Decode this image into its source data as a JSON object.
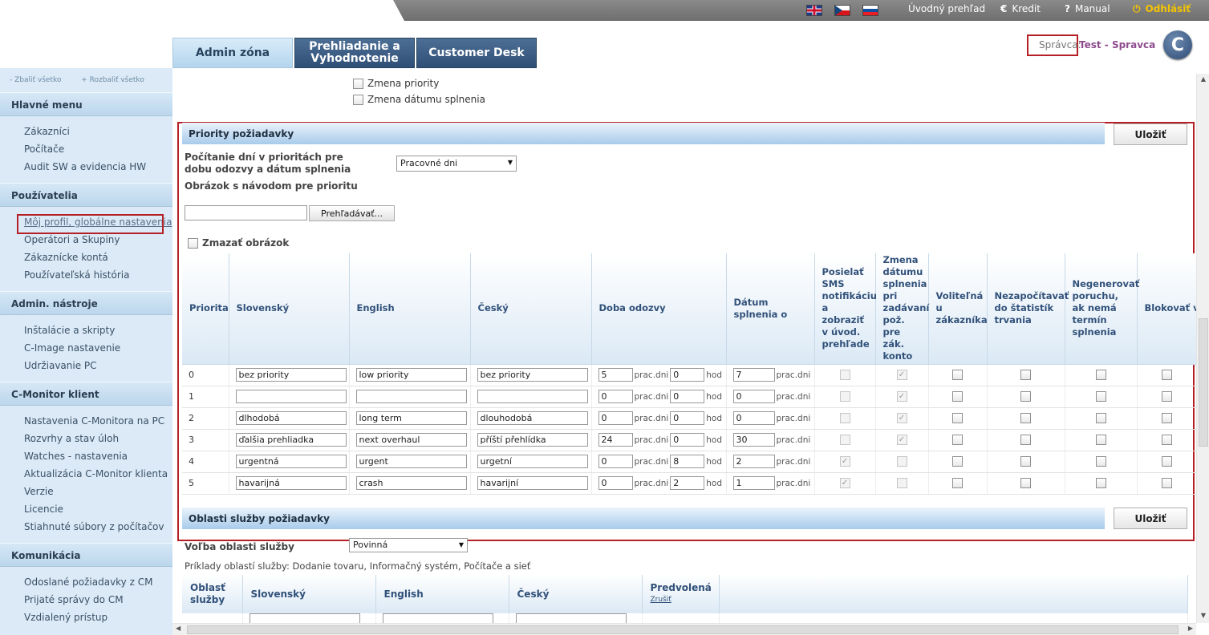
{
  "topbar": {
    "flags": [
      "flag-uk",
      "flag-cz",
      "flag-sk"
    ],
    "home": "Úvodný prehľad",
    "credit_icon": "€",
    "credit": "Kredit",
    "manual_icon": "?",
    "manual": "Manual",
    "logout_icon": "⏻",
    "logout": "Odhlásiť"
  },
  "tabs": {
    "admin": "Admin zóna",
    "review_1": "Prehliadanie a",
    "review_2": "Vyhodnotenie",
    "desk": "Customer Desk"
  },
  "user": {
    "label": "Správca:",
    "name": "Test - Spravca",
    "logo": "C"
  },
  "sidebar": {
    "collapse_all": "- Zbaliť všetko",
    "expand_all": "+ Rozbaliť všetko",
    "sections": [
      {
        "title": "Hlavné menu",
        "items": [
          "Zákazníci",
          "Počítače",
          "Audit SW a evidencia HW"
        ]
      },
      {
        "title": "Používatelia",
        "items": [
          "Môj profil, globálne nastavenia",
          "Operátori a Skupiny",
          "Zákaznícke kontá",
          "Používateľská história"
        ]
      },
      {
        "title": "Admin. nástroje",
        "items": [
          "Inštalácie a skripty",
          "C-Image nastavenie",
          "Udržiavanie PC"
        ]
      },
      {
        "title": "C-Monitor klient",
        "items": [
          "Nastavenia C-Monitora na PC",
          "Rozvrhy a stav úloh",
          "Watches - nastavenia",
          "Aktualizácia C-Monitor klienta",
          "Verzie",
          "Licencie",
          "Stiahnuté súbory z počítačov"
        ]
      },
      {
        "title": "Komunikácia",
        "items": [
          "Odoslané požiadavky z CM",
          "Prijaté správy do CM",
          "Vzdialený prístup"
        ]
      }
    ]
  },
  "main": {
    "top_checks": [
      "Zmena priority",
      "Zmena dátumu splnenia"
    ],
    "priorities": {
      "title": "Priority požiadavky",
      "save": "Uložiť",
      "counting_label": "Počítanie dní v prioritách pre dobu odozvy a dátum splnenia",
      "counting_value": "Pracovné dni",
      "image_label": "Obrázok s návodom pre prioritu",
      "browse": "Prehľadávať...",
      "delete_image": "Zmazať obrázok",
      "columns": [
        "Priorita",
        "Slovenský",
        "English",
        "Český",
        "Doba odozvy",
        "Dátum splnenia o",
        "Posielať SMS notifikáciu a zobraziť v úvod. prehľade",
        "Zmena dátumu splnenia pri zadávaní pož. pre zák. konto",
        "Voliteľná u zákazníka",
        "Nezapočítavať do štatistík trvania",
        "Negenerovať poruchu, ak nemá termín splnenia",
        "Blokovať v easyclick poziadavka"
      ],
      "unit_days": "prac.dni",
      "unit_hours": "hod",
      "rows": [
        {
          "id": "0",
          "sk": "bez priority",
          "en": "low priority",
          "cz": "bez priority",
          "resp_days": "5",
          "resp_hours": "0",
          "due_days": "7",
          "sms_checked": false,
          "change_checked": true
        },
        {
          "id": "1",
          "sk": "",
          "en": "",
          "cz": "",
          "resp_days": "0",
          "resp_hours": "0",
          "due_days": "0",
          "sms_checked": false,
          "change_checked": true
        },
        {
          "id": "2",
          "sk": "dlhodobá",
          "en": "long term",
          "cz": "dlouhodobá",
          "resp_days": "0",
          "resp_hours": "0",
          "due_days": "0",
          "sms_checked": false,
          "change_checked": true
        },
        {
          "id": "3",
          "sk": "ďalšia prehliadka",
          "en": "next overhaul",
          "cz": "příští přehlídka",
          "resp_days": "24",
          "resp_hours": "0",
          "due_days": "30",
          "sms_checked": false,
          "change_checked": true
        },
        {
          "id": "4",
          "sk": "urgentná",
          "en": "urgent",
          "cz": "urgetní",
          "resp_days": "0",
          "resp_hours": "8",
          "due_days": "2",
          "sms_checked": true,
          "change_checked": false
        },
        {
          "id": "5",
          "sk": "havarijná",
          "en": "crash",
          "cz": "havarijní",
          "resp_days": "0",
          "resp_hours": "2",
          "due_days": "1",
          "sms_checked": true,
          "change_checked": false
        }
      ]
    },
    "service": {
      "title": "Oblasti služby požiadavky",
      "save": "Uložiť",
      "choice_label": "Voľba oblasti služby",
      "choice_value": "Povinná",
      "examples": "Príklady oblastí služby: Dodanie tovaru, Informačný systém, Počítače a sieť",
      "columns": [
        "Oblasť služby",
        "Slovenský",
        "English",
        "Český",
        "Predvolená"
      ],
      "reset": "Zrušiť"
    }
  }
}
